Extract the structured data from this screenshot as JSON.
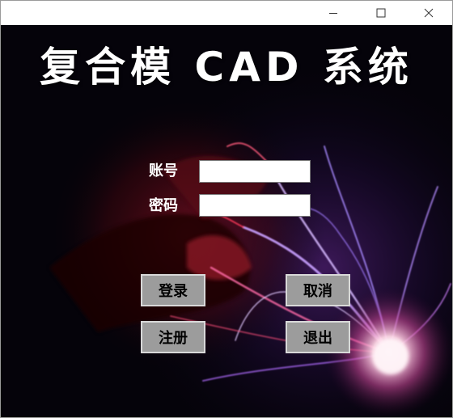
{
  "window": {
    "title": "",
    "controls": [
      "minimize-icon",
      "maximize-icon",
      "close-icon"
    ]
  },
  "app": {
    "title": "复合模 CAD 系统"
  },
  "form": {
    "account_label": "账号",
    "account_value": "",
    "password_label": "密码",
    "password_value": ""
  },
  "buttons": {
    "login": "登录",
    "cancel": "取消",
    "register": "注册",
    "exit": "退出"
  },
  "colors": {
    "background": "#05030a",
    "button_face": "#9c9c9c",
    "plasma_core": "#ffe8f0",
    "plasma_glow": "#c04fd0"
  }
}
